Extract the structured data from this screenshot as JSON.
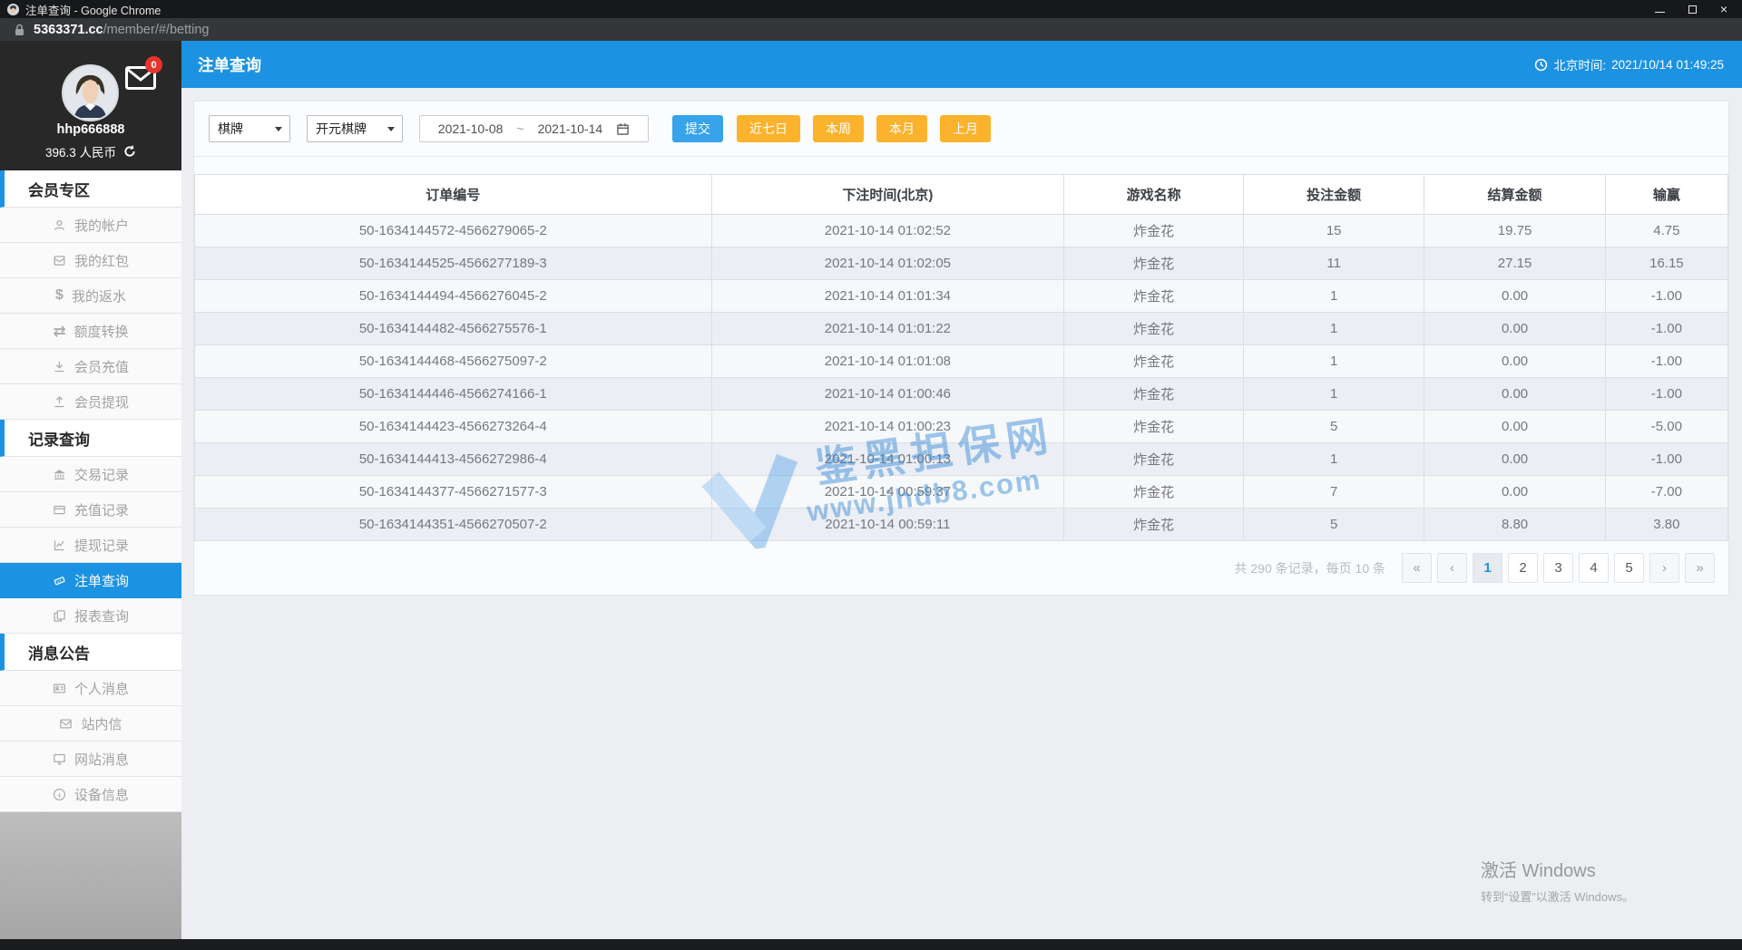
{
  "browser": {
    "tab_title": "注单查询 - Google Chrome",
    "url_host": "5363371.cc",
    "url_path": "/member/#/betting"
  },
  "header": {
    "title": "注单查询",
    "time_label": "北京时间:",
    "time_value": "2021/10/14 01:49:25"
  },
  "user": {
    "name": "hhp666888",
    "balance": "396.3 人民币",
    "unread_count": "0"
  },
  "sidebar": {
    "sections": [
      {
        "title": "会员专区",
        "items": [
          {
            "icon": "user",
            "label": "我的帐户"
          },
          {
            "icon": "red-envelope",
            "label": "我的红包"
          },
          {
            "icon": "dollar",
            "label": "我的返水"
          },
          {
            "icon": "transfer",
            "label": "额度转换"
          },
          {
            "icon": "deposit",
            "label": "会员充值"
          },
          {
            "icon": "withdraw",
            "label": "会员提现"
          }
        ]
      },
      {
        "title": "记录查询",
        "items": [
          {
            "icon": "bank",
            "label": "交易记录"
          },
          {
            "icon": "card",
            "label": "充值记录"
          },
          {
            "icon": "chart",
            "label": "提现记录"
          },
          {
            "icon": "ticket",
            "label": "注单查询",
            "active": true
          },
          {
            "icon": "report",
            "label": "报表查询"
          }
        ]
      },
      {
        "title": "消息公告",
        "items": [
          {
            "icon": "id-card",
            "label": "个人消息"
          },
          {
            "icon": "mail",
            "label": "站内信"
          },
          {
            "icon": "monitor",
            "label": "网站消息"
          },
          {
            "icon": "info",
            "label": "设备信息"
          }
        ]
      }
    ]
  },
  "filters": {
    "category": "棋牌",
    "platform": "开元棋牌",
    "date_from": "2021-10-08",
    "date_sep": "~",
    "date_to": "2021-10-14",
    "submit": "提交",
    "quick": [
      "近七日",
      "本周",
      "本月",
      "上月"
    ]
  },
  "table": {
    "columns": [
      "订单编号",
      "下注时间(北京)",
      "游戏名称",
      "投注金额",
      "结算金额",
      "输赢"
    ],
    "col_widths": [
      "33.7%",
      "23%",
      "11.7%",
      "11.8%",
      "11.8%",
      "8%"
    ],
    "rows": [
      [
        "50-1634144572-4566279065-2",
        "2021-10-14 01:02:52",
        "炸金花",
        "15",
        "19.75",
        "4.75"
      ],
      [
        "50-1634144525-4566277189-3",
        "2021-10-14 01:02:05",
        "炸金花",
        "11",
        "27.15",
        "16.15"
      ],
      [
        "50-1634144494-4566276045-2",
        "2021-10-14 01:01:34",
        "炸金花",
        "1",
        "0.00",
        "-1.00"
      ],
      [
        "50-1634144482-4566275576-1",
        "2021-10-14 01:01:22",
        "炸金花",
        "1",
        "0.00",
        "-1.00"
      ],
      [
        "50-1634144468-4566275097-2",
        "2021-10-14 01:01:08",
        "炸金花",
        "1",
        "0.00",
        "-1.00"
      ],
      [
        "50-1634144446-4566274166-1",
        "2021-10-14 01:00:46",
        "炸金花",
        "1",
        "0.00",
        "-1.00"
      ],
      [
        "50-1634144423-4566273264-4",
        "2021-10-14 01:00:23",
        "炸金花",
        "5",
        "0.00",
        "-5.00"
      ],
      [
        "50-1634144413-4566272986-4",
        "2021-10-14 01:00:13",
        "炸金花",
        "1",
        "0.00",
        "-1.00"
      ],
      [
        "50-1634144377-4566271577-3",
        "2021-10-14 00:59:37",
        "炸金花",
        "7",
        "0.00",
        "-7.00"
      ],
      [
        "50-1634144351-4566270507-2",
        "2021-10-14 00:59:11",
        "炸金花",
        "5",
        "8.80",
        "3.80"
      ]
    ]
  },
  "pagination": {
    "summary": "共 290 条记录，每页 10 条",
    "buttons": [
      "«",
      "‹",
      "1",
      "2",
      "3",
      "4",
      "5",
      "›",
      "»"
    ],
    "active": "1"
  },
  "watermark": {
    "title": "鉴黑担保网",
    "url": "www.jhdb8.com"
  },
  "activation": {
    "line1": "激活 Windows",
    "line2": "转到“设置”以激活 Windows。"
  }
}
